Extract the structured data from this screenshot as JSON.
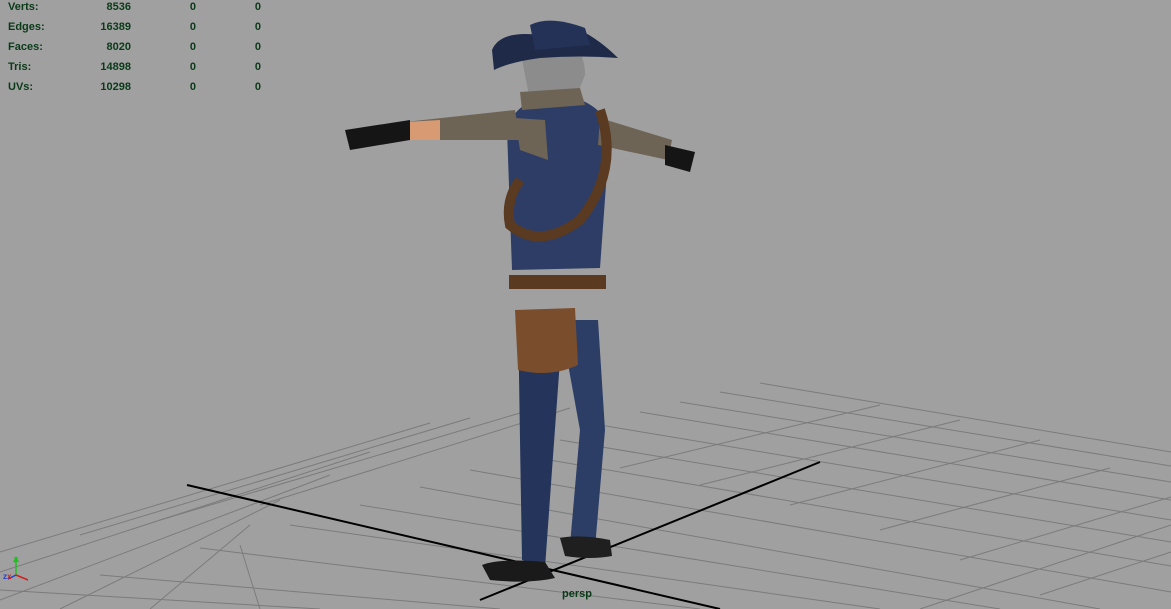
{
  "hud": {
    "rows": [
      {
        "label": "Verts:",
        "v1": "8536",
        "v2": "0",
        "v3": "0"
      },
      {
        "label": "Edges:",
        "v1": "16389",
        "v2": "0",
        "v3": "0"
      },
      {
        "label": "Faces:",
        "v1": "8020",
        "v2": "0",
        "v3": "0"
      },
      {
        "label": "Tris:",
        "v1": "14898",
        "v2": "0",
        "v3": "0"
      },
      {
        "label": "UVs:",
        "v1": "10298",
        "v2": "0",
        "v3": "0"
      }
    ]
  },
  "camera": {
    "name": "persp"
  },
  "colors": {
    "background": "#a0a0a0",
    "hud_text": "#0a3a18",
    "grid_line": "#7b7b7b",
    "grid_axis": "#000000"
  },
  "icons": {
    "axis_gizmo": "xyz-axis-icon",
    "character": "cowboy-character-model"
  }
}
